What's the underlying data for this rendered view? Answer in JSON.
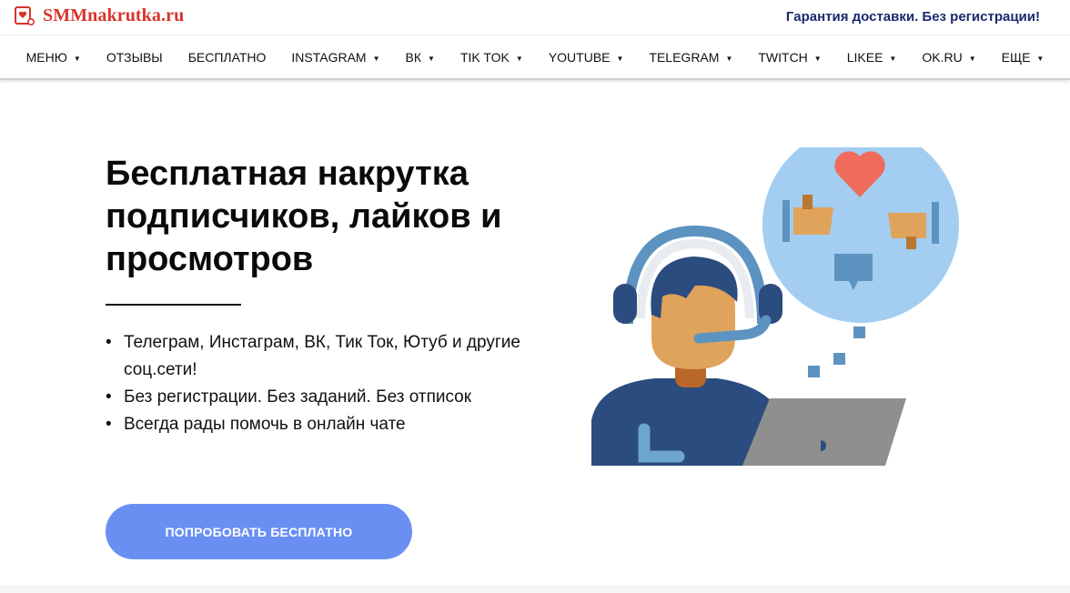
{
  "logo": {
    "text": "SMMnakrutka.ru",
    "icon": "heart-card-icon"
  },
  "header": {
    "tagline": "Гарантия доставки. Без регистрации!"
  },
  "nav": [
    {
      "label": "МЕНЮ",
      "caret": true
    },
    {
      "label": "ОТЗЫВЫ",
      "caret": false
    },
    {
      "label": "БЕСПЛАТНО",
      "caret": false
    },
    {
      "label": "INSTAGRAM",
      "caret": true
    },
    {
      "label": "ВК",
      "caret": true
    },
    {
      "label": "TIK TOK",
      "caret": true
    },
    {
      "label": "YOUTUBE",
      "caret": true
    },
    {
      "label": "TELEGRAM",
      "caret": true
    },
    {
      "label": "TWITCH",
      "caret": true
    },
    {
      "label": "LIKEE",
      "caret": true
    },
    {
      "label": "OK.RU",
      "caret": true
    },
    {
      "label": "ЕЩЕ",
      "caret": true
    }
  ],
  "hero": {
    "title": "Бесплатная накрутка подписчиков, лайков и просмотров",
    "bullets": [
      "Телеграм, Инстаграм, ВК, Тик Ток, Ютуб и другие соц.сети!",
      "Без регистрации. Без заданий. Без отписок",
      "Всегда рады помочь в онлайн чате"
    ],
    "cta_label": "ПОПРОБОВАТЬ БЕСПЛАТНО"
  },
  "illustration": {
    "icon": "support-operator-illustration"
  },
  "colors": {
    "brand_red": "#d8342b",
    "tagline_navy": "#1a2a6c",
    "cta_blue": "#6a8ff3",
    "bubble_blue": "#a3cdf1",
    "heart_red": "#ef6b5c",
    "shirt_navy": "#2b4c7e",
    "skin_tan": "#dfa35c",
    "laptop_gray": "#8f8f8f"
  }
}
